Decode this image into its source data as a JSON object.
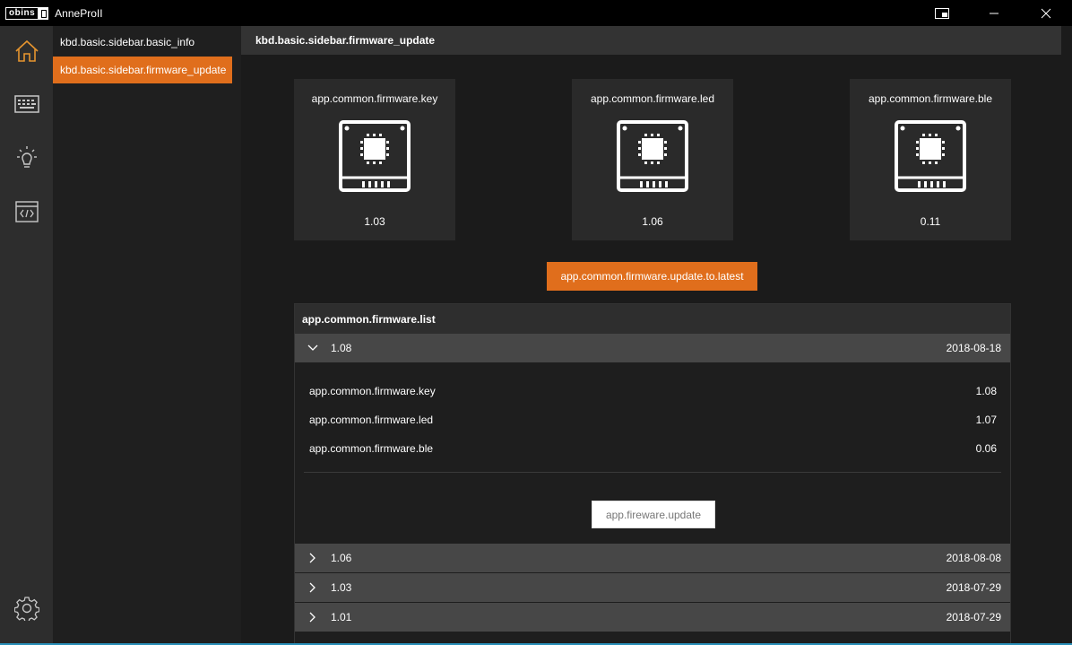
{
  "titlebar": {
    "logo_text": "obins",
    "app_title": "AnneProII"
  },
  "rail": {
    "items": [
      {
        "icon": "home-icon",
        "active": true
      },
      {
        "icon": "keyboard-icon",
        "active": false
      },
      {
        "icon": "light-bulb-icon",
        "active": false
      },
      {
        "icon": "code-window-icon",
        "active": false
      }
    ],
    "bottom_icon": "gear-icon"
  },
  "sidebar": {
    "items": [
      {
        "label": "kbd.basic.sidebar.basic_info",
        "active": false
      },
      {
        "label": "kbd.basic.sidebar.firmware_update",
        "active": true
      }
    ]
  },
  "main": {
    "header": "kbd.basic.sidebar.firmware_update",
    "cards": [
      {
        "title": "app.common.firmware.key",
        "version": "1.03",
        "icon": "chip-icon"
      },
      {
        "title": "app.common.firmware.led",
        "version": "1.06",
        "icon": "chip-icon"
      },
      {
        "title": "app.common.firmware.ble",
        "version": "0.11",
        "icon": "chip-icon"
      }
    ],
    "update_latest_label": "app.common.firmware.update.to.latest",
    "list": {
      "title": "app.common.firmware.list",
      "releases": [
        {
          "version": "1.08",
          "date": "2018-08-18",
          "expanded": true,
          "details": [
            {
              "name": "app.common.firmware.key",
              "value": "1.08"
            },
            {
              "name": "app.common.firmware.led",
              "value": "1.07"
            },
            {
              "name": "app.common.firmware.ble",
              "value": "0.06"
            }
          ],
          "update_label": "app.fireware.update"
        },
        {
          "version": "1.06",
          "date": "2018-08-08",
          "expanded": false
        },
        {
          "version": "1.03",
          "date": "2018-07-29",
          "expanded": false
        },
        {
          "version": "1.01",
          "date": "2018-07-29",
          "expanded": false
        }
      ]
    }
  },
  "colors": {
    "accent": "#e06e1c",
    "background": "#1b1b1b",
    "rail": "#2d2d2d",
    "status_line": "#2a8fb8"
  }
}
